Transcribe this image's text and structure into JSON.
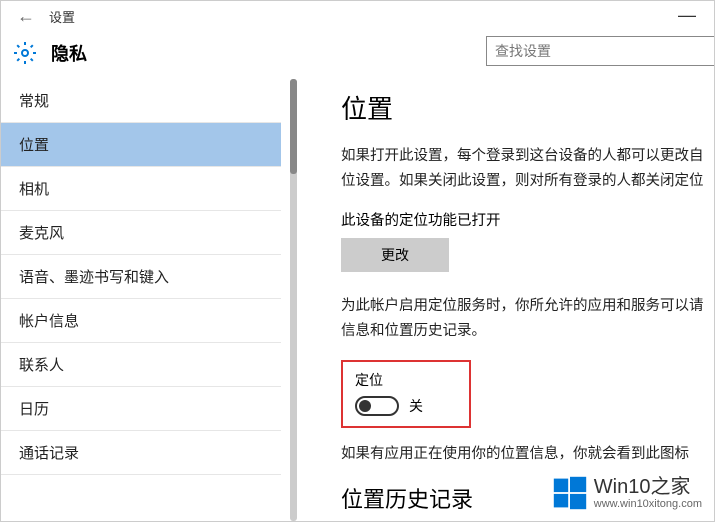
{
  "titlebar": {
    "title": "设置"
  },
  "header": {
    "title": "隐私"
  },
  "search": {
    "placeholder": "查找设置"
  },
  "sidebar": {
    "items": [
      {
        "label": "常规",
        "selected": false
      },
      {
        "label": "位置",
        "selected": true
      },
      {
        "label": "相机",
        "selected": false
      },
      {
        "label": "麦克风",
        "selected": false
      },
      {
        "label": "语音、墨迹书写和键入",
        "selected": false
      },
      {
        "label": "帐户信息",
        "selected": false
      },
      {
        "label": "联系人",
        "selected": false
      },
      {
        "label": "日历",
        "selected": false
      },
      {
        "label": "通话记录",
        "selected": false
      }
    ]
  },
  "content": {
    "heading": "位置",
    "paragraph1": "如果打开此设置，每个登录到这台设备的人都可以更改自位设置。如果关闭此设置，则对所有登录的人都关闭定位",
    "status_line": "此设备的定位功能已打开",
    "change_button": "更改",
    "paragraph2": "为此帐户启用定位服务时，你所允许的应用和服务可以请信息和位置历史记录。",
    "toggle": {
      "label": "定位",
      "state": "关"
    },
    "paragraph3": "如果有应用正在使用你的位置信息，你就会看到此图标",
    "history_heading": "位置历史记录"
  },
  "watermark": {
    "title": "Win10之家",
    "sub": "www.win10xitong.com"
  }
}
